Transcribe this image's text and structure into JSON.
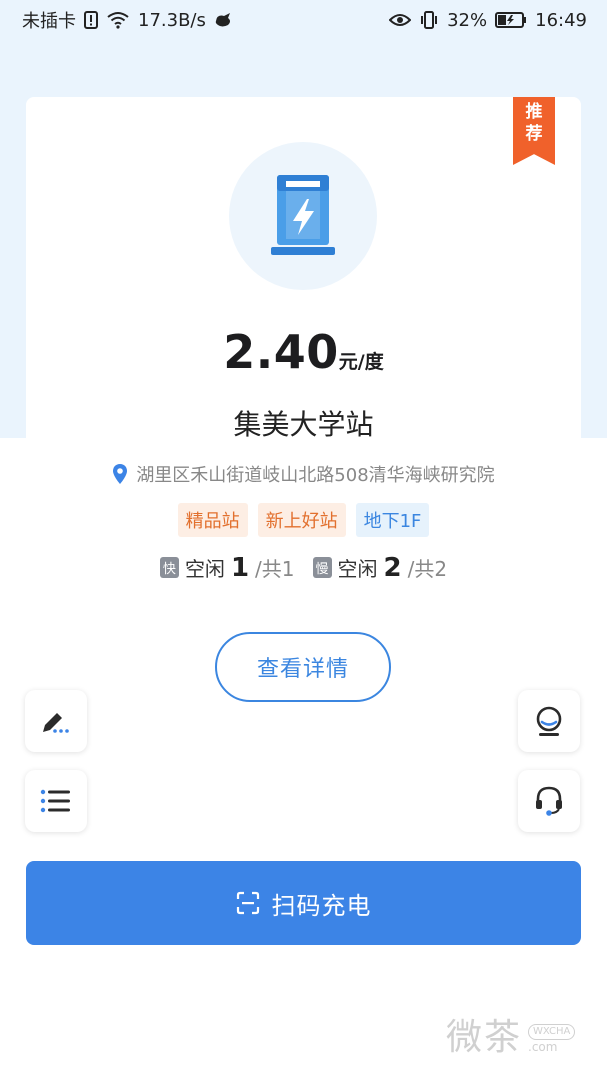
{
  "status_bar": {
    "carrier": "未插卡",
    "speed": "17.3B/s",
    "battery": "32%",
    "time": "16:49"
  },
  "card": {
    "ribbon": [
      "推",
      "荐"
    ],
    "price_value": "2.40",
    "price_unit": "元/度",
    "station_name": "集美大学站",
    "address": "湖里区禾山街道岐山北路508清华海峡研究院",
    "tags": [
      {
        "label": "精品站",
        "style": "orange"
      },
      {
        "label": "新上好站",
        "style": "orange"
      },
      {
        "label": "地下1F",
        "style": "blue"
      }
    ],
    "fast": {
      "badge": "快",
      "label": "空闲",
      "free": "1",
      "total": "/共1"
    },
    "slow": {
      "badge": "慢",
      "label": "空闲",
      "free": "2",
      "total": "/共2"
    }
  },
  "detail_button": "查看详情",
  "scan_button": "扫码充电",
  "watermark": {
    "cn": "微茶",
    "pill": "WXCHA",
    "domain": ".com"
  },
  "colors": {
    "primary": "#3c84e6",
    "ribbon": "#f0612b",
    "background_top": "#eaf4fd"
  }
}
